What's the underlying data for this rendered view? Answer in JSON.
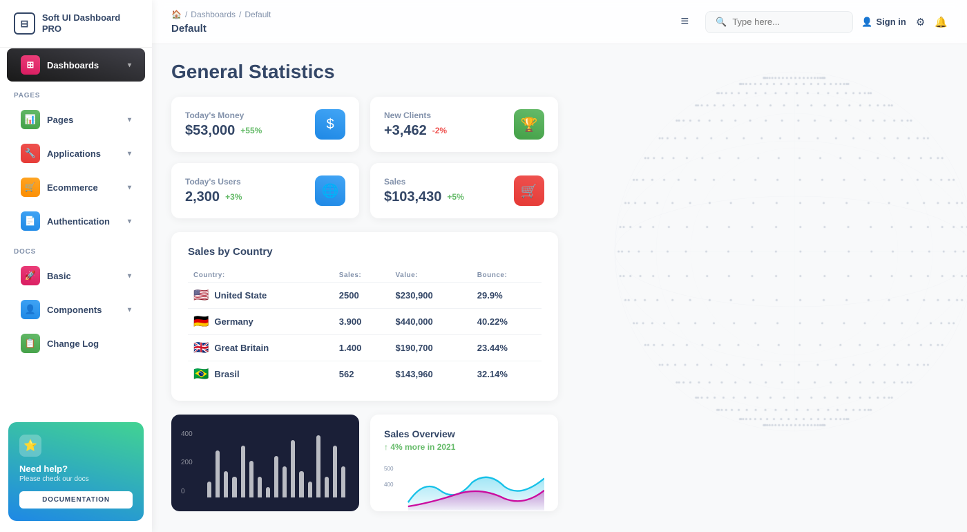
{
  "logo": {
    "icon": "⊟",
    "text": "Soft UI Dashboard PRO"
  },
  "sidebar": {
    "sections": [
      {
        "label": "",
        "items": [
          {
            "id": "dashboards",
            "label": "Dashboards",
            "icon": "⊞",
            "iconClass": "sidebar-icon-apps",
            "active": true,
            "chevron": "▾"
          }
        ]
      },
      {
        "label": "PAGES",
        "items": [
          {
            "id": "pages",
            "label": "Pages",
            "icon": "📊",
            "iconClass": "sidebar-icon-pages",
            "active": false,
            "chevron": "▾"
          },
          {
            "id": "applications",
            "label": "Applications",
            "icon": "🔧",
            "iconClass": "sidebar-icon-apps",
            "active": false,
            "chevron": "▾"
          },
          {
            "id": "ecommerce",
            "label": "Ecommerce",
            "icon": "🛒",
            "iconClass": "sidebar-icon-ecomm",
            "active": false,
            "chevron": "▾"
          },
          {
            "id": "authentication",
            "label": "Authentication",
            "icon": "📄",
            "iconClass": "sidebar-icon-auth",
            "active": false,
            "chevron": "▾"
          }
        ]
      },
      {
        "label": "DOCS",
        "items": [
          {
            "id": "basic",
            "label": "Basic",
            "icon": "🚀",
            "iconClass": "sidebar-icon-basic",
            "active": false,
            "chevron": "▾"
          },
          {
            "id": "components",
            "label": "Components",
            "icon": "👤",
            "iconClass": "sidebar-icon-comp",
            "active": false,
            "chevron": "▾"
          },
          {
            "id": "changelog",
            "label": "Change Log",
            "icon": "📋",
            "iconClass": "sidebar-icon-changelog",
            "active": false
          }
        ]
      }
    ],
    "help": {
      "icon": "⭐",
      "title": "Need help?",
      "subtitle": "Please check our docs",
      "button_label": "DOCUMENTATION"
    }
  },
  "topbar": {
    "breadcrumb": {
      "home_icon": "🏠",
      "items": [
        "Dashboards",
        "Default"
      ],
      "current": "Default"
    },
    "search_placeholder": "Type here...",
    "sign_in_label": "Sign in",
    "hamburger": "≡"
  },
  "page_title": "General Statistics",
  "stats": [
    {
      "label": "Today's Money",
      "value": "$53,000",
      "badge": "+55%",
      "badge_type": "pos",
      "icon": "$",
      "icon_class": "stats-icon-money"
    },
    {
      "label": "New Clients",
      "value": "+3,462",
      "badge": "-2%",
      "badge_type": "neg",
      "icon": "🏆",
      "icon_class": "stats-icon-clients"
    },
    {
      "label": "Today's Users",
      "value": "2,300",
      "badge": "+3%",
      "badge_type": "pos",
      "icon": "🌐",
      "icon_class": "stats-icon-users"
    },
    {
      "label": "Sales",
      "value": "$103,430",
      "badge": "+5%",
      "badge_type": "pos",
      "icon": "🛒",
      "icon_class": "stats-icon-sales"
    }
  ],
  "sales_by_country": {
    "title": "Sales by Country",
    "columns": [
      "Country:",
      "Sales:",
      "Value:",
      "Bounce:"
    ],
    "rows": [
      {
        "flag": "us",
        "country": "United State",
        "sales": "2500",
        "value": "$230,900",
        "bounce": "29.9%"
      },
      {
        "flag": "de",
        "country": "Germany",
        "sales": "3.900",
        "value": "$440,000",
        "bounce": "40.22%"
      },
      {
        "flag": "gb",
        "country": "Great Britain",
        "sales": "1.400",
        "value": "$190,700",
        "bounce": "23.44%"
      },
      {
        "flag": "br",
        "country": "Brasil",
        "sales": "562",
        "value": "$143,960",
        "bounce": "32.14%"
      }
    ]
  },
  "bar_chart": {
    "y_labels": [
      "400",
      "200",
      "0"
    ],
    "bars": [
      15,
      45,
      25,
      20,
      50,
      35,
      20,
      10,
      40,
      30,
      55,
      25,
      15,
      60,
      20,
      50,
      30
    ]
  },
  "sales_overview": {
    "title": "Sales Overview",
    "subtitle": "↑ 4% more in 2021",
    "y_labels": [
      "500",
      "400"
    ]
  }
}
